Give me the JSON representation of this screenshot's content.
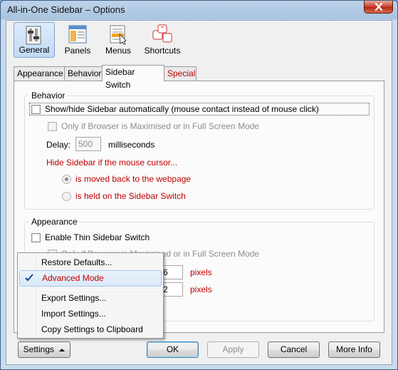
{
  "window": {
    "title": "All-in-One Sidebar – Options"
  },
  "toolbar": [
    {
      "label": "General",
      "icon": "general-icon"
    },
    {
      "label": "Panels",
      "icon": "panels-icon"
    },
    {
      "label": "Menus",
      "icon": "menus-icon"
    },
    {
      "label": "Shortcuts",
      "icon": "shortcuts-icon"
    }
  ],
  "tabs": [
    "Appearance",
    "Behavior",
    "Sidebar Switch",
    "Special"
  ],
  "behavior": {
    "title": "Behavior",
    "auto_show": "Show/hide Sidebar automatically (mouse contact instead of mouse click)",
    "only_maximised": "Only if Browser is Maximised or in Full Screen Mode",
    "delay_label": "Delay:",
    "delay_value": "500",
    "delay_unit": "milliseconds",
    "hide_heading": "Hide Sidebar if the mouse cursor...",
    "radio_moved": "is moved back to the webpage",
    "radio_held": "is held on the Sidebar Switch"
  },
  "appearance": {
    "title": "Appearance",
    "thin_switch": "Enable Thin Sidebar Switch",
    "only_maximised": "Only if Browser is Maximised or in Full Screen Mode",
    "value1": "6",
    "value2": "2",
    "unit": "pixels"
  },
  "menu": {
    "items": [
      "Restore Defaults...",
      "Advanced Mode",
      "Export Settings...",
      "Import Settings...",
      "Copy Settings to Clipboard"
    ]
  },
  "buttons": {
    "settings": "Settings",
    "ok": "OK",
    "apply": "Apply",
    "cancel": "Cancel",
    "more_info": "More Info"
  }
}
